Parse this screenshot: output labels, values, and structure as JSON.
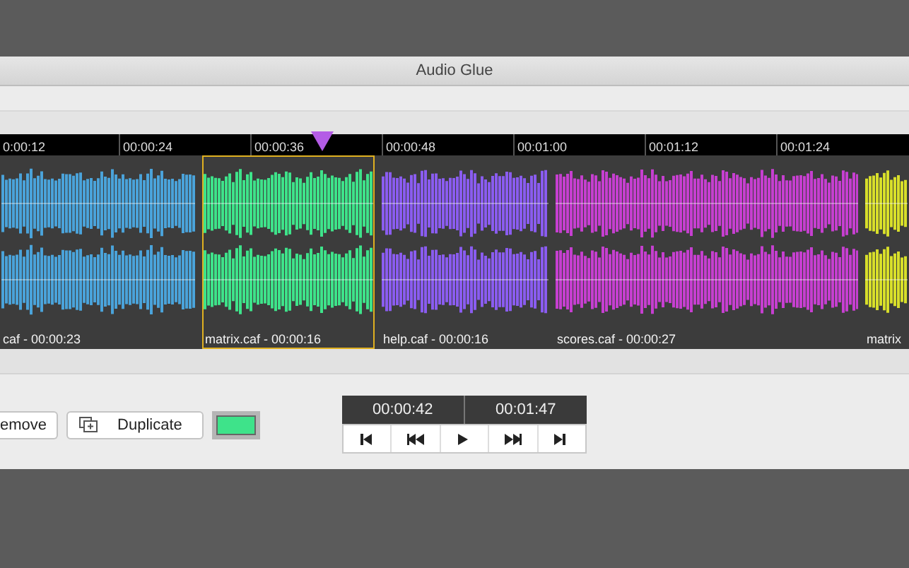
{
  "window": {
    "title": "Audio Glue"
  },
  "ruler": {
    "ticks": [
      "0:00:12",
      "00:00:24",
      "00:00:36",
      "00:00:48",
      "00:01:00",
      "00:01:12",
      "00:01:24"
    ]
  },
  "clips": [
    {
      "label": "caf - 00:00:23",
      "color": "#4aa3da",
      "selected": false
    },
    {
      "label": "matrix.caf - 00:00:16",
      "color": "#3ee38a",
      "selected": true
    },
    {
      "label": "help.caf - 00:00:16",
      "color": "#8a5cf0",
      "selected": false
    },
    {
      "label": "scores.caf - 00:00:27",
      "color": "#c63fd0",
      "selected": false
    },
    {
      "label": "matrix",
      "color": "#d8df2a",
      "selected": false
    }
  ],
  "controls": {
    "remove": "emove",
    "duplicate": "Duplicate"
  },
  "transport": {
    "position": "00:00:42",
    "duration": "00:01:47"
  }
}
